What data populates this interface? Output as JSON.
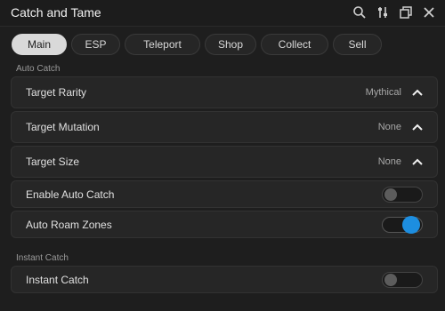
{
  "window": {
    "title": "Catch and Tame"
  },
  "toolbar_icons": [
    "search-icon",
    "sliders-icon",
    "window-icon",
    "close-icon"
  ],
  "tabs": [
    {
      "label": "Main",
      "active": true
    },
    {
      "label": "ESP",
      "active": false
    },
    {
      "label": "Teleport",
      "active": false
    },
    {
      "label": "Shop",
      "active": false
    },
    {
      "label": "Collect",
      "active": false
    },
    {
      "label": "Sell",
      "active": false
    }
  ],
  "sections": {
    "auto_catch": "Auto Catch",
    "instant_catch": "Instant Catch"
  },
  "auto_catch": {
    "target_rarity": {
      "label": "Target Rarity",
      "value": "Mythical"
    },
    "target_mutation": {
      "label": "Target Mutation",
      "value": "None"
    },
    "target_size": {
      "label": "Target Size",
      "value": "None"
    },
    "enable_auto_catch": {
      "label": "Enable Auto Catch",
      "on": false
    },
    "auto_roam_zones": {
      "label": "Auto Roam Zones",
      "on": true
    }
  },
  "instant": {
    "instant_catch": {
      "label": "Instant Catch",
      "on": false
    }
  },
  "colors": {
    "accent": "#1d8ee0",
    "background": "#1e1e1e",
    "row": "#262626",
    "active_tab": "#d9d9d9"
  }
}
